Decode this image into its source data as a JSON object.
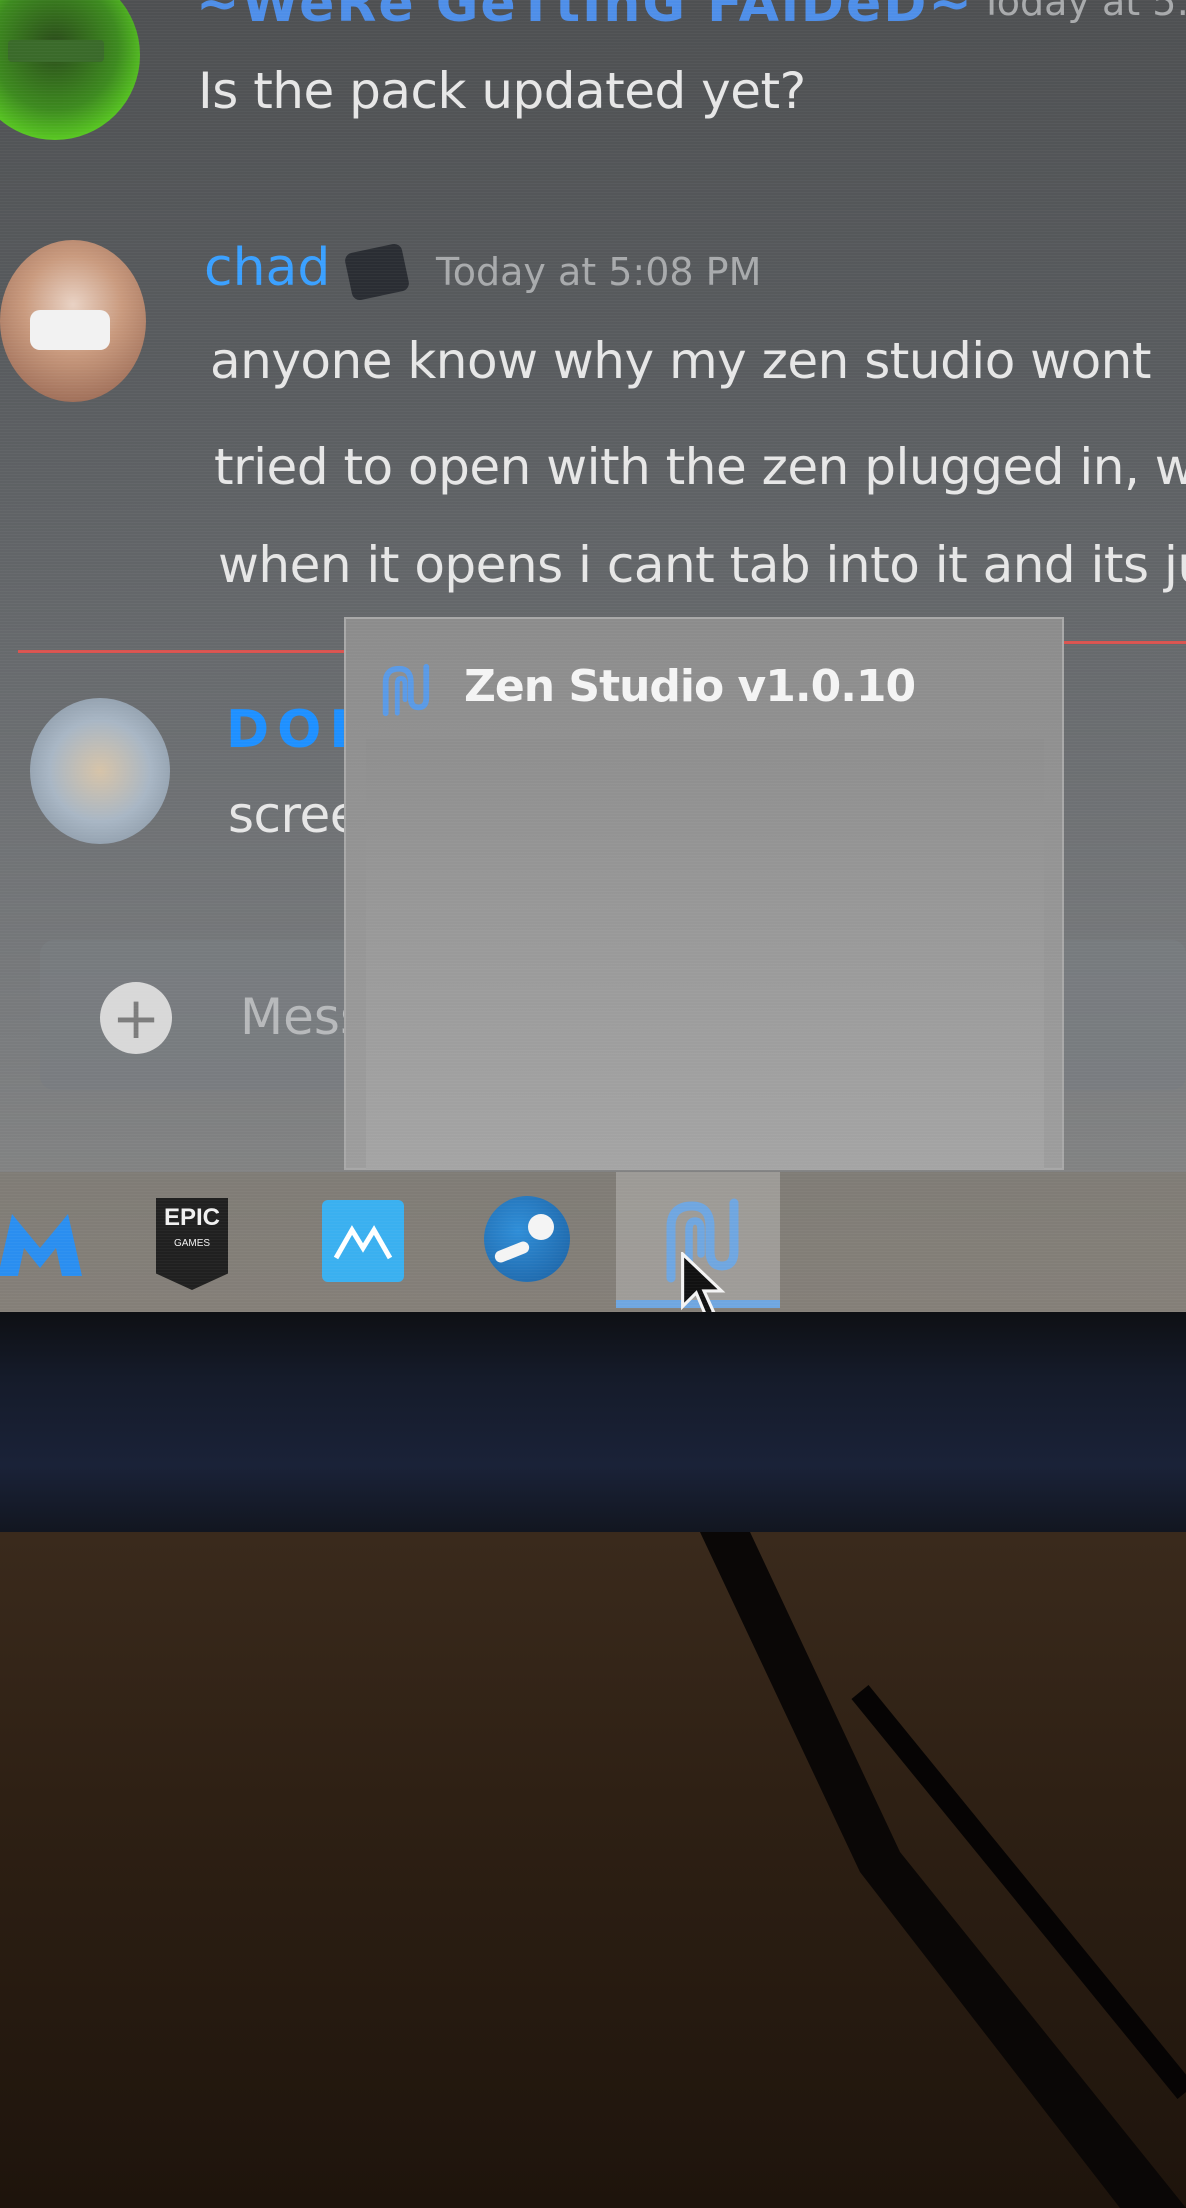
{
  "chat": {
    "top_message": {
      "username": "~WeRe GeTtInG FAiDeD~",
      "timestamp": "Today at 5:",
      "text": "Is the pack updated yet?"
    },
    "chad_message": {
      "username": "chad",
      "timestamp": "Today at 5:08 PM",
      "lines": [
        "anyone know why my zen studio wont",
        "tried to open with the zen plugged in, w",
        "when it opens i cant tab into it and its ju"
      ]
    },
    "next_message": {
      "username_partial": "DOI",
      "text_partial": "scree"
    },
    "input_placeholder": "Mess",
    "add_icon": "+"
  },
  "taskbar_preview": {
    "title": "Zen Studio v1.0.10",
    "icon": "zen-studio-icon"
  },
  "taskbar": {
    "apps": [
      {
        "name": "malwarebytes",
        "icon": "malwarebytes-icon"
      },
      {
        "name": "Epic Games",
        "icon": "epic-games-icon",
        "label_top": "EPIC",
        "label_bottom": "GAMES"
      },
      {
        "name": "app-blue",
        "icon": "blue-app-icon"
      },
      {
        "name": "Steam",
        "icon": "steam-icon"
      },
      {
        "name": "Zen Studio",
        "icon": "zen-studio-icon",
        "active": true
      }
    ]
  },
  "colors": {
    "chad_name": "#3aa0ff",
    "doi_name": "#1e90ff",
    "zen_blue": "#6fa6e0",
    "new_divider": "#d9534f"
  }
}
